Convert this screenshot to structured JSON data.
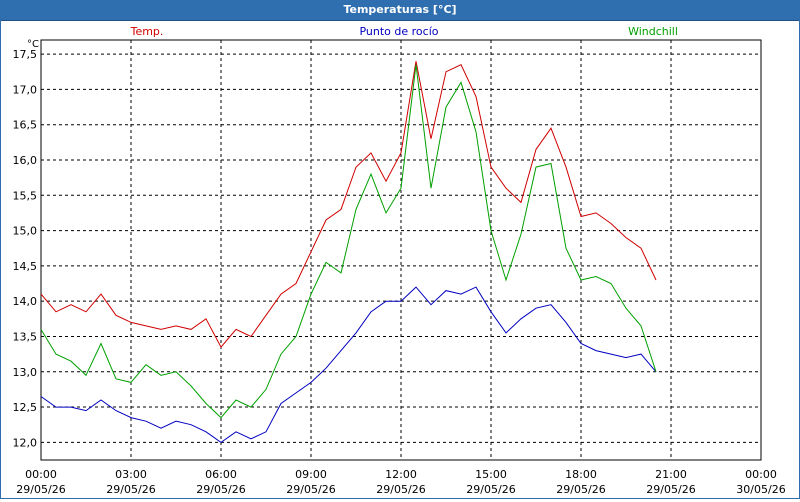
{
  "window": {
    "title": "Temperaturas [°C]"
  },
  "chart_data": {
    "type": "line",
    "title": "Temperaturas [°C]",
    "ylabel": "°C",
    "ylim": [
      11.75,
      17.7
    ],
    "yticks": [
      "12,0",
      "12,5",
      "13,0",
      "13,5",
      "14,0",
      "14,5",
      "15,0",
      "15,5",
      "16,0",
      "16,5",
      "17,0",
      "17,5"
    ],
    "xticks": [
      {
        "time": "00:00",
        "date": "29/05/26"
      },
      {
        "time": "03:00",
        "date": "29/05/26"
      },
      {
        "time": "06:00",
        "date": "29/05/26"
      },
      {
        "time": "09:00",
        "date": "29/05/26"
      },
      {
        "time": "12:00",
        "date": "29/05/26"
      },
      {
        "time": "15:00",
        "date": "29/05/26"
      },
      {
        "time": "18:00",
        "date": "29/05/26"
      },
      {
        "time": "21:00",
        "date": "29/05/26"
      },
      {
        "time": "00:00",
        "date": "30/05/26"
      }
    ],
    "xlim_hours": [
      0,
      24
    ],
    "grid": true,
    "legend_placement": "top",
    "x_hours": [
      0,
      0.5,
      1,
      1.5,
      2,
      2.5,
      3,
      3.5,
      4,
      4.5,
      5,
      5.5,
      6,
      6.5,
      7,
      7.5,
      8,
      8.5,
      9,
      9.5,
      10,
      10.5,
      11,
      11.5,
      12,
      12.5,
      13,
      13.5,
      14,
      14.5,
      15,
      15.5,
      16,
      16.5,
      17,
      17.5,
      18,
      18.5,
      19,
      19.5,
      20,
      20.5
    ],
    "series": [
      {
        "name": "Temp.",
        "color": "#d00000",
        "values": [
          14.1,
          13.85,
          13.95,
          13.85,
          14.1,
          13.8,
          13.7,
          13.65,
          13.6,
          13.65,
          13.6,
          13.75,
          13.35,
          13.6,
          13.5,
          13.8,
          14.1,
          14.25,
          14.7,
          15.15,
          15.3,
          15.9,
          16.1,
          15.7,
          16.1,
          17.4,
          16.3,
          17.25,
          17.35,
          16.9,
          15.9,
          15.6,
          15.4,
          16.15,
          16.45,
          15.9,
          15.2,
          15.25,
          15.1,
          14.9,
          14.75,
          14.3
        ]
      },
      {
        "name": "Punto de rocío",
        "color": "#0000c0",
        "values": [
          12.65,
          12.5,
          12.5,
          12.45,
          12.6,
          12.45,
          12.35,
          12.3,
          12.2,
          12.3,
          12.25,
          12.15,
          12.0,
          12.15,
          12.05,
          12.15,
          12.55,
          12.7,
          12.85,
          13.05,
          13.3,
          13.55,
          13.85,
          14.0,
          14.0,
          14.2,
          13.95,
          14.15,
          14.1,
          14.2,
          13.85,
          13.55,
          13.75,
          13.9,
          13.95,
          13.7,
          13.4,
          13.3,
          13.25,
          13.2,
          13.25,
          13.0
        ]
      },
      {
        "name": "Windchill",
        "color": "#00a000",
        "values": [
          13.6,
          13.25,
          13.15,
          12.95,
          13.4,
          12.9,
          12.85,
          13.1,
          12.95,
          13.0,
          12.8,
          12.55,
          12.35,
          12.6,
          12.5,
          12.75,
          13.25,
          13.5,
          14.1,
          14.55,
          14.4,
          15.3,
          15.8,
          15.25,
          15.6,
          17.35,
          15.6,
          16.75,
          17.1,
          16.4,
          15.0,
          14.3,
          14.95,
          15.9,
          15.95,
          14.75,
          14.3,
          14.35,
          14.25,
          13.9,
          13.65,
          13.0
        ]
      }
    ]
  }
}
